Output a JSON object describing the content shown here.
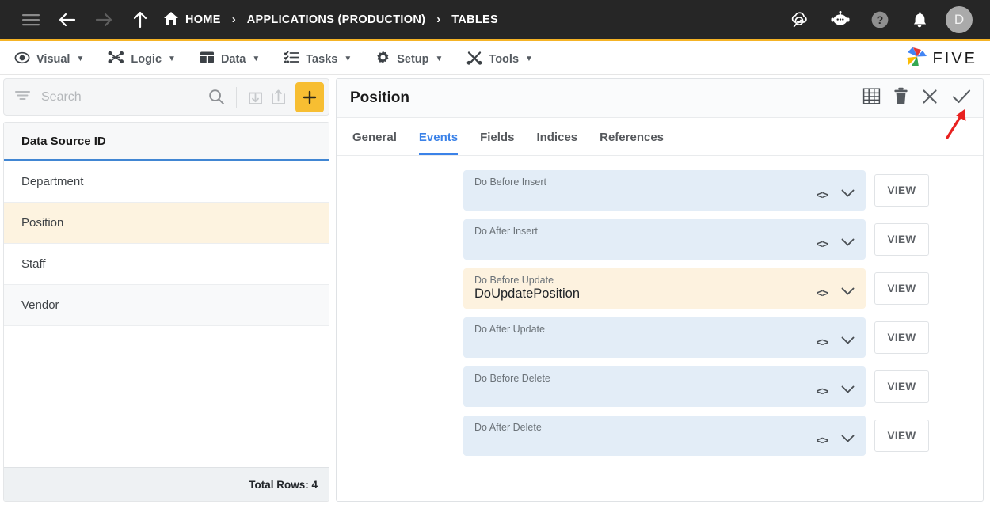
{
  "topbar": {
    "icons": [
      "hamburger-icon",
      "back-arrow-icon",
      "forward-arrow-icon",
      "up-arrow-icon"
    ],
    "breadcrumb": [
      {
        "label": "HOME",
        "icon": "home-icon"
      },
      {
        "label": "APPLICATIONS (PRODUCTION)",
        "icon": ""
      },
      {
        "label": "TABLES",
        "icon": ""
      }
    ],
    "separator": "›",
    "right_icons": [
      "cloud-search-icon",
      "chat-bot-icon",
      "help-icon",
      "notifications-bell-icon"
    ],
    "avatar_initial": "D"
  },
  "menubar": {
    "items": [
      {
        "label": "Visual",
        "icon": "eye-icon"
      },
      {
        "label": "Logic",
        "icon": "nodes-icon"
      },
      {
        "label": "Data",
        "icon": "table-grid-icon"
      },
      {
        "label": "Tasks",
        "icon": "checklist-icon"
      },
      {
        "label": "Setup",
        "icon": "gear-icon"
      },
      {
        "label": "Tools",
        "icon": "tools-icon"
      }
    ],
    "caret": "▼",
    "logo_text": "FIVE"
  },
  "sidebar": {
    "search": {
      "placeholder": "Search",
      "value": ""
    },
    "toolbar_icons": [
      "filter-icon",
      "search-icon",
      "import-icon",
      "export-icon",
      "add-icon"
    ],
    "add_label": "+",
    "column_header": "Data Source ID",
    "rows": [
      {
        "label": "Department",
        "selected": false
      },
      {
        "label": "Position",
        "selected": true
      },
      {
        "label": "Staff",
        "selected": false
      },
      {
        "label": "Vendor",
        "selected": false
      }
    ],
    "footer": "Total Rows: 4"
  },
  "panel": {
    "title": "Position",
    "action_icons": [
      "table-grid-icon",
      "delete-icon",
      "close-icon",
      "save-check-icon"
    ],
    "tabs": [
      {
        "label": "General",
        "active": false
      },
      {
        "label": "Events",
        "active": true
      },
      {
        "label": "Fields",
        "active": false
      },
      {
        "label": "Indices",
        "active": false
      },
      {
        "label": "References",
        "active": false
      }
    ],
    "events": [
      {
        "label": "Do Before Insert",
        "value": "",
        "selected": false,
        "view_label": "VIEW"
      },
      {
        "label": "Do After Insert",
        "value": "",
        "selected": false,
        "view_label": "VIEW"
      },
      {
        "label": "Do Before Update",
        "value": "DoUpdatePosition",
        "selected": true,
        "view_label": "VIEW"
      },
      {
        "label": "Do After Update",
        "value": "",
        "selected": false,
        "view_label": "VIEW"
      },
      {
        "label": "Do Before Delete",
        "value": "",
        "selected": false,
        "view_label": "VIEW"
      },
      {
        "label": "Do After Delete",
        "value": "",
        "selected": false,
        "view_label": "VIEW"
      }
    ],
    "code_icon_glyph": "<>",
    "chevron_glyph": "⌄"
  },
  "annotation": {
    "type": "red-arrow",
    "points_to": "save-check-icon",
    "color": "#e8201f"
  },
  "colors": {
    "accent_yellow": "#f5b325",
    "selected_row": "#fdf3e0",
    "event_row": "#e3edf7",
    "tab_active": "#3b82e8",
    "header_underline": "#4186d3"
  }
}
